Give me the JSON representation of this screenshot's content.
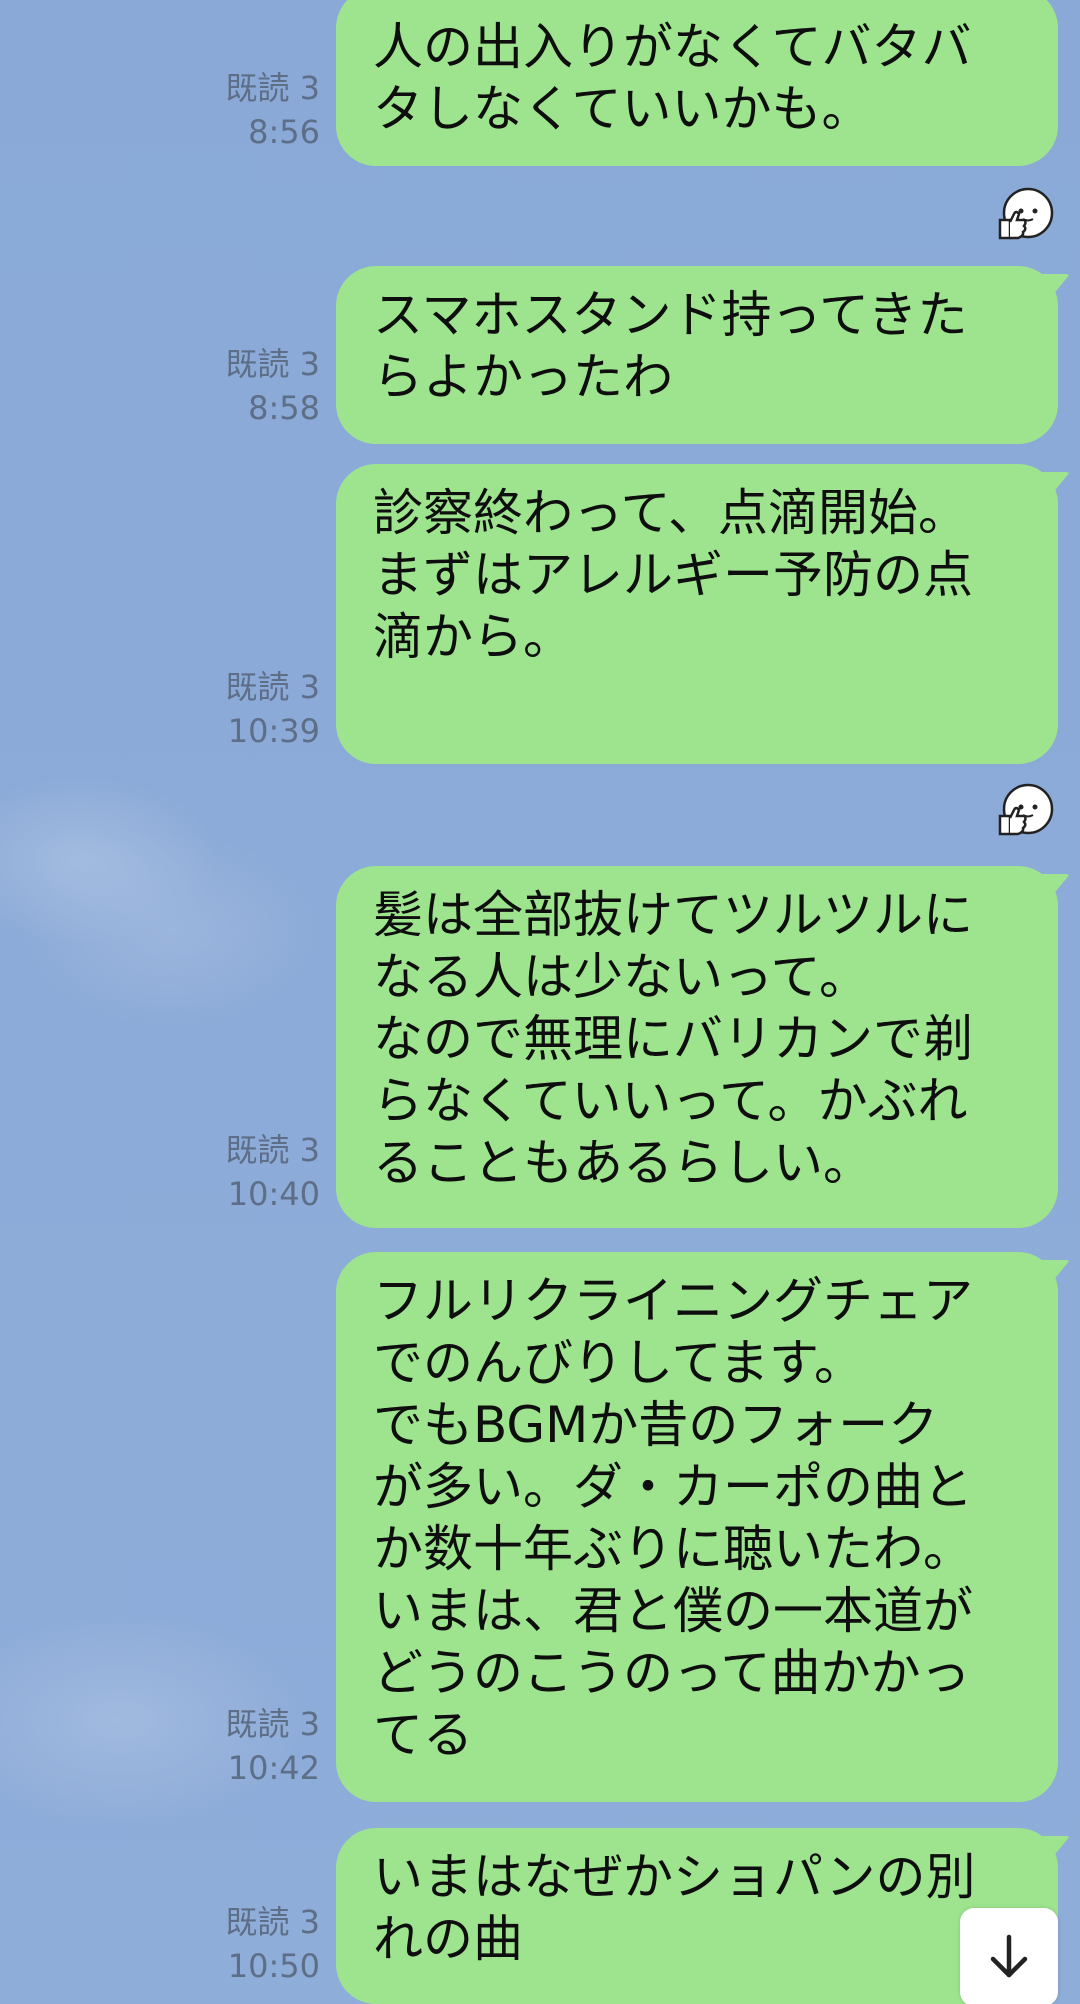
{
  "messages": [
    {
      "read": "既読 3",
      "time": "8:56",
      "text": "人の出入りがなくてバタバ\nタしなくていいかも。"
    },
    {
      "read": "既読 3",
      "time": "8:58",
      "text": "スマホスタンド持ってきた\nらよかったわ"
    },
    {
      "read": "既読 3",
      "time": "10:39",
      "text": "診察終わって、点滴開始。\nまずはアレルギー予防の点\n滴から。"
    },
    {
      "read": "既読 3",
      "time": "10:40",
      "text": "髪は全部抜けてツルツルに\nなる人は少ないって。\nなので無理にバリカンで剃\nらなくていいって。かぶれ\nることもあるらしい。"
    },
    {
      "read": "既読 3",
      "time": "10:42",
      "text": "フルリクライニングチェア\nでのんびりしてます。\nでもBGMか昔のフォーク\nが多い。ダ・カーポの曲と\nか数十年ぶりに聴いたわ。\nいまは、君と僕の一本道が\nどうのこうのって曲かかっ\nてる"
    },
    {
      "read": "既読 3",
      "time": "10:50",
      "text": "いまはなぜかショパンの別\nれの曲"
    }
  ],
  "reactions": [
    {
      "icon": "thumbs-up-sticker-icon"
    },
    {
      "icon": "thumbs-up-sticker-icon"
    }
  ],
  "controls": {
    "scroll_down_icon": "arrow-down-icon"
  },
  "colors": {
    "background": "#8dabd8",
    "bubble": "#9ee48f",
    "meta_text": "#5d6e87"
  }
}
